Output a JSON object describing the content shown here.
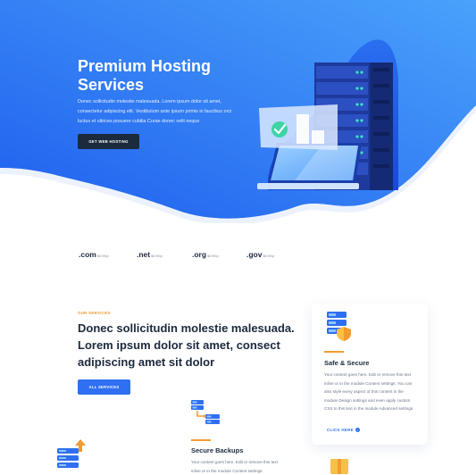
{
  "hero": {
    "title": "Premium Hosting Services",
    "description": "Donec sollicitudin molestie malesuada. Lorem ipsum dolor sit amet, consectetur adipiscing elit. Vestibulum ante ipsum primis in faucibus orci luctus et ultrices posuere cubilia Curae donec velit neque",
    "button_label": "GET WEB HOSTING"
  },
  "domains": [
    {
      "tld": ".com",
      "price": "$8.99/yr"
    },
    {
      "tld": ".net",
      "price": "$8.99/yr"
    },
    {
      "tld": ".org",
      "price": "$8.99/yr"
    },
    {
      "tld": ".gov",
      "price": "$8.99/yr"
    }
  ],
  "services": {
    "eyebrow": "OUR SERVICES",
    "heading": "Donec sollicitudin molestie malesuada. Lorem ipsum dolor sit amet, consect adipiscing amet sit dolor",
    "button_label": "ALL SERVICES"
  },
  "cards": {
    "safe_secure": {
      "title": "Safe & Secure",
      "text": "Your content goes here. Edit or remove this text inline or in the module Content settings. You can also style every aspect of this content in the module Design settings and even apply custom CSS to this text in the module Advanced settings.",
      "link_label": "CLICK HERE"
    },
    "secure_backups": {
      "title": "Secure Backups",
      "text": "Your content goes here. Edit or remove this text inline or in the module Content settings."
    }
  },
  "colors": {
    "hero_gradient_start": "#1f5fee",
    "hero_gradient_end": "#4aa2fb",
    "dark_button": "#1c2a3e",
    "accent_orange": "#f29b30",
    "accent_blue": "#2f6ff2"
  },
  "icons": {
    "illustration": "server-rack-laptop-illustration",
    "card": "server-shield-icon",
    "backup": "server-transfer-icon",
    "upload": "server-upload-icon",
    "box": "package-icon",
    "link_arrow": "arrow-right-icon"
  }
}
